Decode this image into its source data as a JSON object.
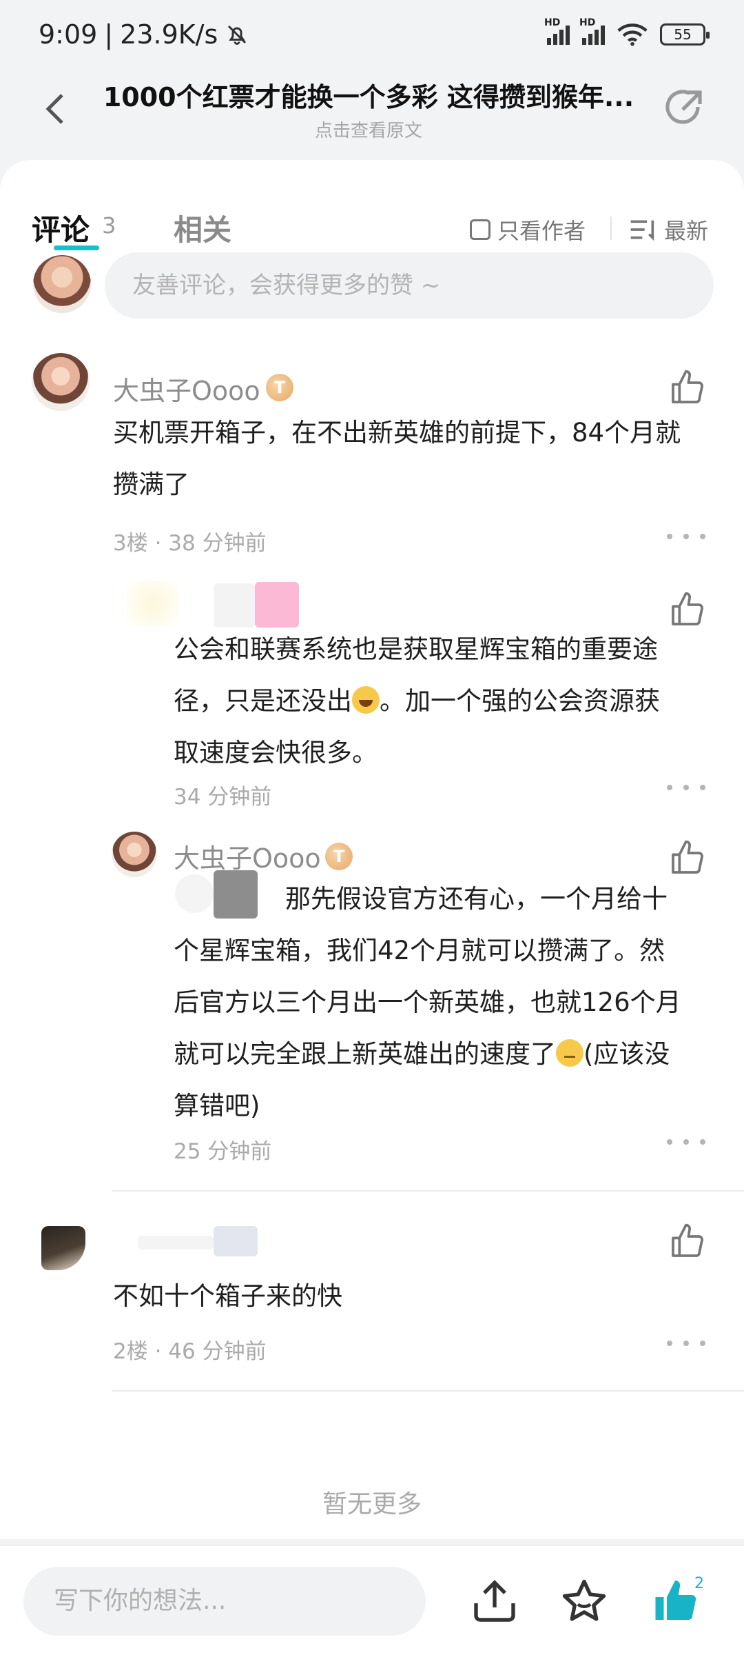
{
  "status_bar": {
    "time": "9:09",
    "speed": "23.9K/s",
    "battery": "55",
    "signal_label": "HD"
  },
  "header": {
    "title": "1000个红票才能换一个多彩 这得攒到猴年...",
    "subtitle": "点击查看原文"
  },
  "tabs": {
    "comments_label": "评论",
    "comments_count": "3",
    "related_label": "相关",
    "author_only_label": "只看作者",
    "sort_label": "最新"
  },
  "comment_input": {
    "placeholder": "友善评论，会获得更多的赞 ~"
  },
  "comments": [
    {
      "username": "大虫子Oooo",
      "badge": "T",
      "text_lines": [
        "买机票开箱子，在不出新英雄的前提下，84个月就",
        "攒满了"
      ],
      "meta": "3楼 · 38 分钟前",
      "replies": [
        {
          "username": "",
          "text_lines": [
            "公会和联赛系统也是获取星辉宝箱的重要途",
            "径，只是还没出",
            "。加一个强的公会资源获",
            "取速度会快很多。"
          ],
          "meta": "34 分钟前"
        },
        {
          "username": "大虫子Oooo",
          "badge": "T",
          "text_lines": [
            "那先假设官方还有心，一个月给十",
            "个星辉宝箱，我们42个月就可以攒满了。然",
            "后官方以三个月出一个新英雄，也就126个月",
            "就可以完全跟上新英雄出的速度了",
            "(应该没",
            "算错吧)"
          ],
          "meta": "25 分钟前"
        }
      ]
    },
    {
      "username": "",
      "text_lines": [
        "不如十个箱子来的快"
      ],
      "meta": "2楼 · 46 分钟前",
      "replies": []
    }
  ],
  "footer_text": "暂无更多",
  "bottom_bar": {
    "write_placeholder": "写下你的想法...",
    "like_count": "2"
  },
  "colors": {
    "accent": "#18c1c9",
    "background": "#f2f3f5",
    "like_active": "#18b3c6"
  },
  "icons": [
    "back-arrow-icon",
    "share-icon",
    "checkbox-icon",
    "sort-icon",
    "thumbs-up-icon",
    "more-icon",
    "upload-icon",
    "star-icon"
  ]
}
